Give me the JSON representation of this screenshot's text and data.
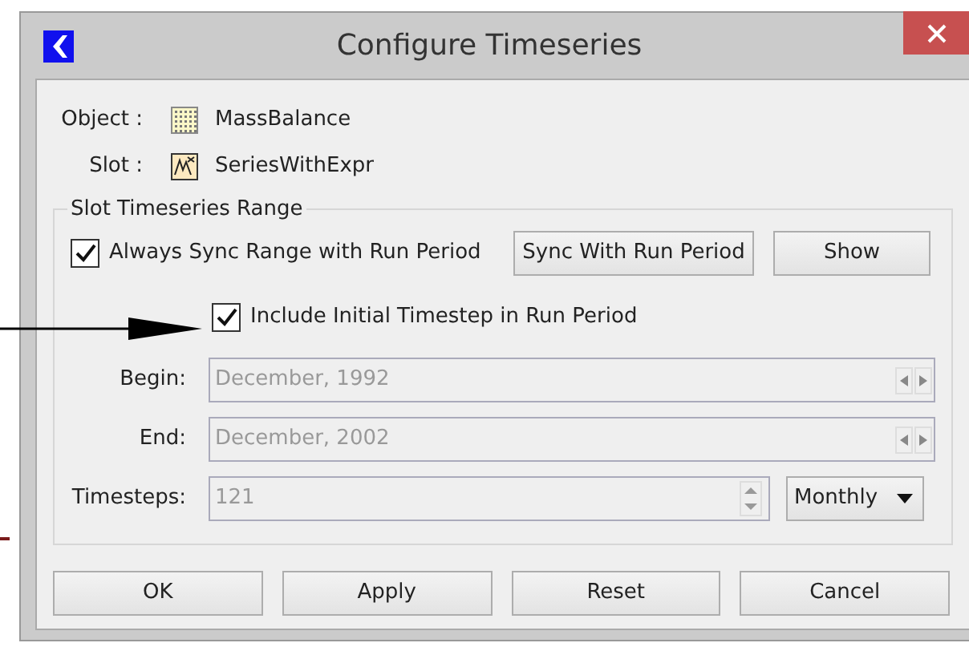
{
  "window": {
    "title": "Configure Timeseries"
  },
  "info": [
    {
      "label": "Object :",
      "kind": "table",
      "value": "MassBalance"
    },
    {
      "label": "Slot :",
      "kind": "series",
      "value": "SeriesWithExpr"
    }
  ],
  "range": {
    "title": "Slot Timeseries Range",
    "always_sync": {
      "label": "Always Sync Range with Run Period",
      "checked": true
    },
    "sync_button": "Sync With Run Period",
    "show_button": "Show",
    "include_initial": {
      "label": "Include Initial Timestep in Run Period",
      "checked": true
    },
    "begin": {
      "label": "Begin:",
      "value": "December, 1992",
      "disabled": true
    },
    "end": {
      "label": "End:",
      "value": "December, 2002",
      "disabled": true
    },
    "timesteps": {
      "label": "Timesteps:",
      "value": "121",
      "disabled": true
    },
    "interval": "Monthly"
  },
  "buttons": [
    "OK",
    "Apply",
    "Reset",
    "Cancel"
  ]
}
